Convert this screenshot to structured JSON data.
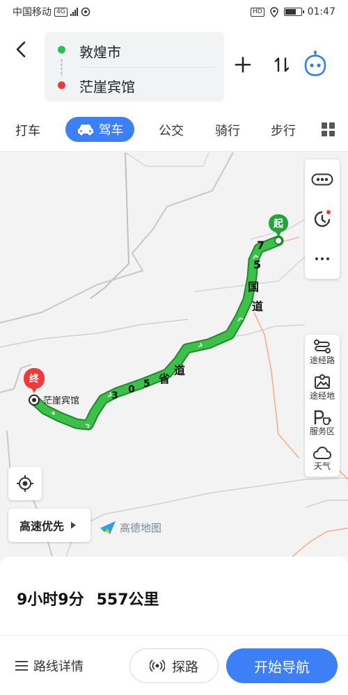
{
  "status_bar": {
    "carrier": "中国移动",
    "network_badge": "4G",
    "hd_badge": "HD",
    "time": "01:47",
    "battery_level": 0.75
  },
  "route": {
    "start": "敦煌市",
    "end": "茫崖宾馆",
    "start_color": "#27c05a",
    "end_color": "#f03a3a"
  },
  "tabs": [
    "打车",
    "驾车",
    "公交",
    "骑行",
    "步行"
  ],
  "active_tab": "驾车",
  "map": {
    "start_marker": "起",
    "end_marker": "终",
    "destination_label": "茫崖宾馆",
    "route_color": "#2fb43a",
    "road_labels": {
      "national": [
        "7",
        "5",
        "国",
        "道"
      ],
      "provincial": [
        "3",
        "0",
        "5",
        "省",
        "道"
      ]
    },
    "side_tools": [
      "途经路",
      "途经地",
      "服务区",
      "天气"
    ],
    "route_preference": "高速优先",
    "brand": "高德地图"
  },
  "summary": {
    "duration": "9小时9分",
    "distance": "557公里"
  },
  "actions": {
    "route_details": "路线详情",
    "explore": "探路",
    "start_navigation": "开始导航"
  },
  "colors": {
    "accent": "#3d7ff6"
  }
}
